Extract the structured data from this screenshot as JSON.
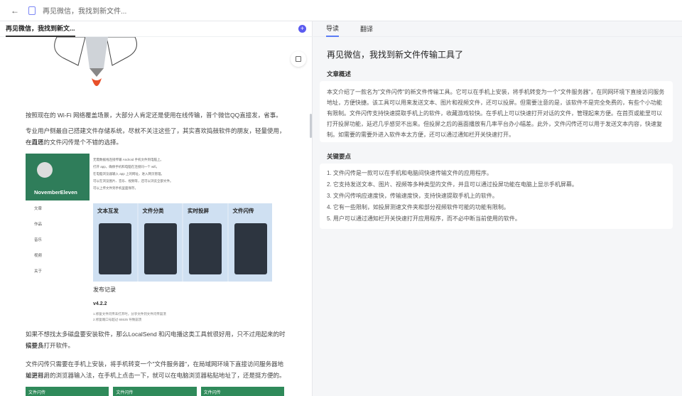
{
  "topbar": {
    "title": "再见微信，我找到新文件..."
  },
  "left": {
    "tab": "再见微信，我找到新文...",
    "para1": "按照现在的 Wi-Fi 网络覆盖场景，大部分人肯定还是使用在线传输，普个微信QQ直接发，省事。",
    "para2a": "专业用户侧最自己搭建文件存储系统，尽就不关注这些了，其实喜欢捣鼓软件的朋友，轻量使用，一直还",
    "para2b": "在周思的文件闪传是个不错的选择。",
    "app": {
      "name": "NovemberEleven",
      "menu": [
        "文章",
        "作品",
        "音乐",
        "视频",
        "关于"
      ],
      "notes": [
        "无需数据线连接传输 Android 手机文件到电脑上。",
        "打开 app，确保手机和电脑在连接同一个 wifi。",
        "在电脑浏览器输入 app 上的网址，进入网页管理。",
        "可以在浏览图片、音乐、视频等，还可以浏览全部文件。",
        "可以上传文件到手机里面保存。"
      ],
      "features": [
        "文本互发",
        "文件分类",
        "实时投屏",
        "文件闪传"
      ],
      "release": "发布记录",
      "version": "v4.2.2",
      "version_notes": [
        "1.修复文件闪传未打开时，分享文件到文件闪传崩溃",
        "2.修复端口号超过 65535 导致崩溃"
      ]
    },
    "para3a": "如果不想找太多磁盘要安装软件，那么LocalSend 和闪电播这类工具就很好用，只不过用起来的时候要多",
    "para3b": "搞些几打开软件。",
    "para4a": "文件闪传只需要在手机上安装，将手机转变一个\"文件服务器\"，在局域网环境下直接访问服务器地址进行，",
    "para4b": "如更易用的浏览器输入法，在手机上点击一下，就可以在电脑浏览器粘贴地址了，还是挺方便的。",
    "green_screens": [
      "文件闪传",
      "文件闪传",
      "文件闪传"
    ]
  },
  "right": {
    "tabs": [
      "导读",
      "翻译"
    ],
    "title": "再见微信，我找到新文件传输工具了",
    "summary_heading": "文章概述",
    "summary": "本文介绍了一款名为\"文件闪传\"的新文件传输工具。它可以在手机上安装，将手机转变为一个\"文件服务器\"，在同网环境下直接访问服务地址，方便快捷。该工具可以用来发送文本、图片和视频文件，还可以投屏。但需要注意的是，该软件不是完全免费的，有些个小功能有限制。文件闪传支持快速提取手机上的软件，收藏游戏较快。在手机上可以快速打开对话的文件，管理起来方便。在首页或能里可以打开投屏功能，延迟几乎感觉不出来。但投屏之后的画面播放有几率平台办小幅差。此外，文件闪传还可以用于发送文本内容，快速复制。如需要的需要外进入软件本太方便，还可以通过通知栏开关快速打开。",
    "points_heading": "关键要点",
    "points": [
      "1. 文件闪传是一款可以在手机和电脑间快速传输文件的应用程序。",
      "2. 它支持发送文本、图片、视频等多种类型的文件，并且可以通过投屏功能在电脑上显示手机屏幕。",
      "3. 文件闪传响应速度快，传输速度快，支持快速提取手机上的软件。",
      "4. 它有一些限制，如投屏测速文件夹和部分视频软件可能的功能有限制。",
      "5. 用户可以通过通知栏开关快速打开应用程序，而不必中断当前使用的软件。"
    ]
  }
}
